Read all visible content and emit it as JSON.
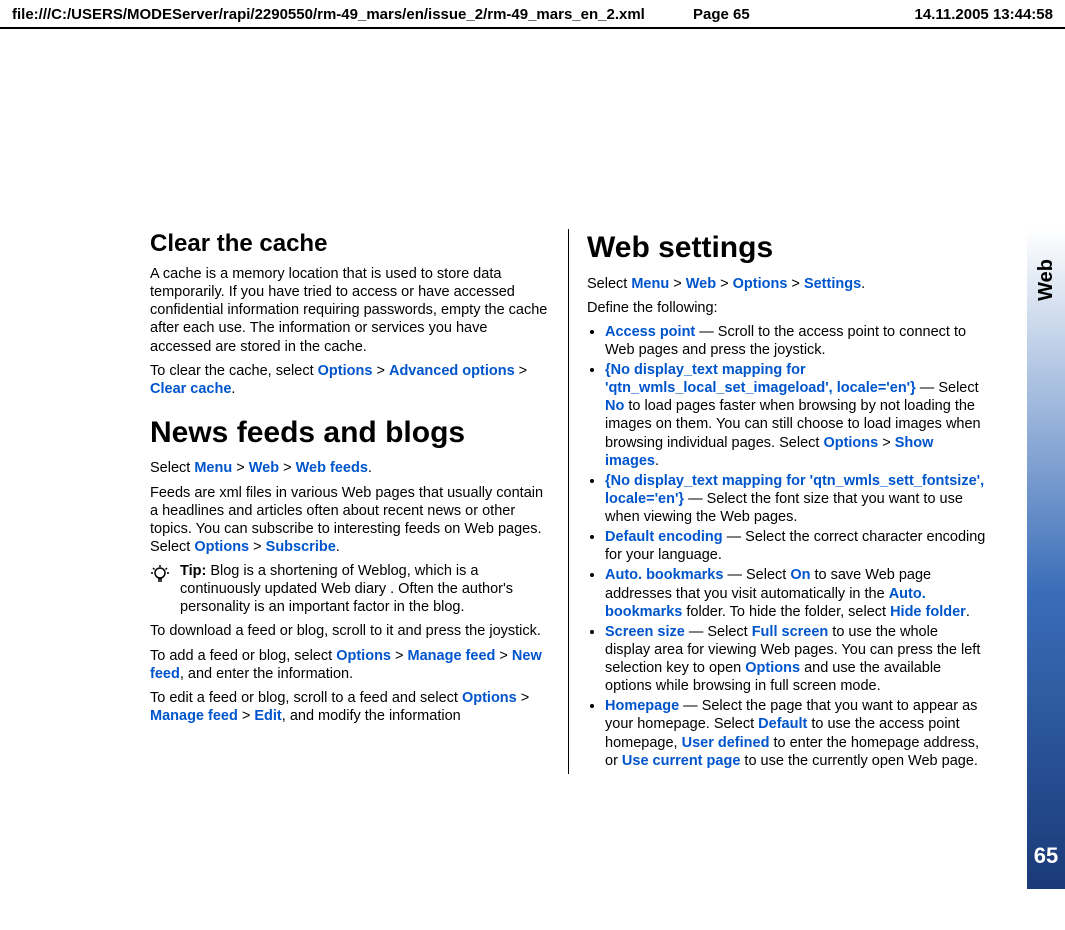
{
  "header": {
    "path": "file:///C:/USERS/MODEServer/rapi/2290550/rm-49_mars/en/issue_2/rm-49_mars_en_2.xml",
    "page": "Page 65",
    "datetime": "14.11.2005 13:44:58"
  },
  "sidebar": {
    "tab": "Web",
    "page_number": "65"
  },
  "left": {
    "h_cache": "Clear the cache",
    "p_cache1": "A cache is a memory location that is used to store data temporarily. If you have tried to access or have accessed confidential information requiring passwords, empty the cache after each use. The information or services you have accessed are stored in the cache.",
    "p_cache2a": "To clear the cache, select ",
    "options": "Options",
    "gt": " > ",
    "advopt": "Advanced options",
    "clearcache": "Clear cache",
    "period": ".",
    "h_news": "News feeds and blogs",
    "p_news1a": "Select ",
    "menu": "Menu",
    "web": "Web",
    "webfeeds": "Web feeds",
    "p_news2a": "Feeds are xml files in various Web pages that usually contain a headlines and articles often about recent news or other topics. You can subscribe to interesting feeds on Web pages. Select ",
    "subscribe": "Subscribe",
    "tip_label": "Tip:",
    "tip_text": " Blog is a shortening of Weblog, which is a continuously updated Web diary . Often the author's personality is an important factor in the blog.",
    "p_dl": "To download a feed or blog, scroll to it and press the joystick.",
    "p_add_a": "To add a feed or blog, select ",
    "managefeed": "Manage feed",
    "newfeed": "New feed",
    "p_add_b": ", and enter the information.",
    "p_edit_a": "To edit a feed or blog, scroll to a feed and select ",
    "edit": "Edit",
    "p_edit_b": ", and modify the information"
  },
  "right": {
    "h_settings": "Web settings",
    "p_sel_a": "Select ",
    "menu": "Menu",
    "gt": " > ",
    "web": "Web",
    "options": "Options",
    "settings": "Settings",
    "period": ".",
    "p_define": "Define the following:",
    "li1_a": "Access point",
    "li1_b": " — Scroll to the access point to connect to Web pages and press the joystick.",
    "li2_a": "{No display_text mapping for 'qtn_wmls_local_set_imageload', locale='en'}",
    "li2_b": " — Select ",
    "no": "No",
    "li2_c": " to load pages faster when browsing by not loading the images on them. You can still choose to load images when browsing individual pages. Select ",
    "showimages": "Show images",
    "li3_a": "{No display_text mapping for 'qtn_wmls_sett_fontsize', locale='en'}",
    "li3_b": " — Select the font size that you want to use when viewing the Web pages.",
    "li4_a": "Default encoding",
    "li4_b": " — Select the correct character encoding for your language.",
    "li5_a": "Auto. bookmarks",
    "li5_b": " — Select ",
    "on": "On",
    "li5_c": " to save Web page addresses that you visit automatically in the ",
    "autobm": "Auto. bookmarks",
    "li5_d": " folder. To hide the folder, select ",
    "hidefolder": "Hide folder",
    "li6_a": "Screen size",
    "li6_b": " — Select ",
    "fullscreen": "Full screen",
    "li6_c": " to use the whole display area for viewing Web pages. You can press the left selection key to open ",
    "li6_d": " and use the available options while browsing in full screen mode.",
    "li7_a": "Homepage",
    "li7_b": " — Select the page that you want to appear as your homepage. Select ",
    "default": "Default",
    "li7_c": " to use the access point homepage, ",
    "userdef": "User defined",
    "li7_d": " to enter the homepage address, or ",
    "usecurrent": "Use current page",
    "li7_e": " to use the currently open Web page."
  }
}
